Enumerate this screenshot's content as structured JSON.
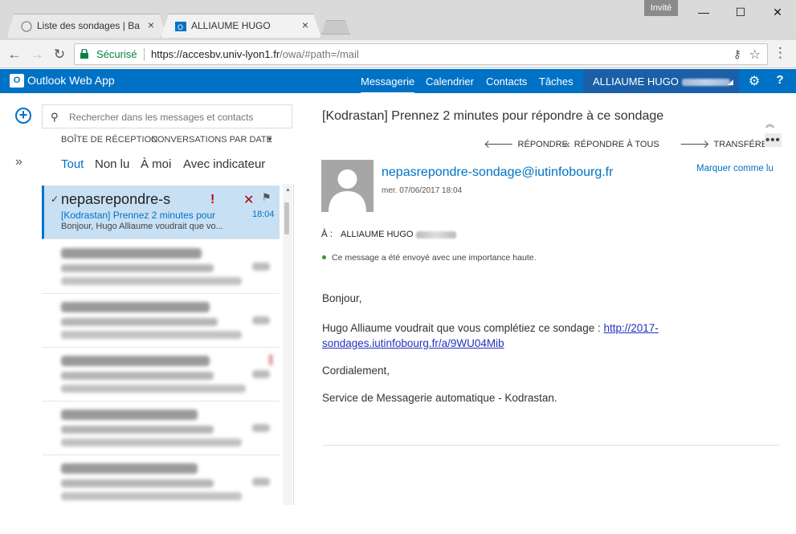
{
  "browser": {
    "tabs": [
      {
        "title": "Liste des sondages | Back",
        "close": "×"
      },
      {
        "title": "ALLIAUME HUGO",
        "close": "×"
      }
    ],
    "profile_badge": "Invité",
    "window_controls": {
      "minimize": "—",
      "maximize": "☐",
      "close": "✕"
    },
    "nav": {
      "back": "←",
      "forward": "→",
      "reload": "↻"
    },
    "security_label": "Sécurisé",
    "url_host": "https://accesbv.univ-lyon1.fr",
    "url_path": "/owa/#path=/mail",
    "icons": [
      "lock-icon",
      "key-icon",
      "star-icon",
      "menu-icon"
    ]
  },
  "owa": {
    "app_logo": "O",
    "app_name": "Outlook Web App",
    "nav": {
      "mail": "Messagerie",
      "calendar": "Calendrier",
      "contacts": "Contacts",
      "tasks": "Tâches"
    },
    "user_name": "ALLIAUME HUGO",
    "accent_color": "#0072c6"
  },
  "list": {
    "search_placeholder": "Rechercher dans les messages et contacts",
    "folder": "BOÎTE DE RÉCEPTION",
    "sort": "CONVERSATIONS PAR DATE",
    "filters": {
      "all": "Tout",
      "unread": "Non lu",
      "to_me": "À moi",
      "flagged": "Avec indicateur"
    },
    "selected_item": {
      "check": "✓",
      "sender": "nepasrepondre-s",
      "importance": "!",
      "delete": "✕",
      "flag": "⚑",
      "subject": "[Kodrastan] Prennez 2 minutes pour",
      "time": "18:04",
      "preview": "Bonjour,  Hugo Alliaume voudrait que vo..."
    }
  },
  "reading": {
    "subject": "[Kodrastan] Prennez 2 minutes pour répondre à ce sondage",
    "actions": {
      "reply": "RÉPONDRE",
      "reply_all": "RÉPONDRE À TOUS",
      "forward": "TRANSFÉRER",
      "more": "•••"
    },
    "sender_email": "nepasrepondre-sondage@iutinfobourg.fr",
    "date": "mer. 07/06/2017 18:04",
    "mark_unread": "Marquer comme lu",
    "to_label": "À :",
    "to_value": "ALLIAUME HUGO",
    "importance_note": "Ce message a été envoyé avec une importance haute.",
    "body": {
      "greeting": "Bonjour,",
      "line1": "Hugo Alliaume voudrait que vous complétiez ce sondage :",
      "link": "http://2017-sondages.iutinfobourg.fr/a/9WU04Mib",
      "regards": "Cordialement,",
      "signature": "Service de Messagerie automatique - Kodrastan."
    }
  }
}
